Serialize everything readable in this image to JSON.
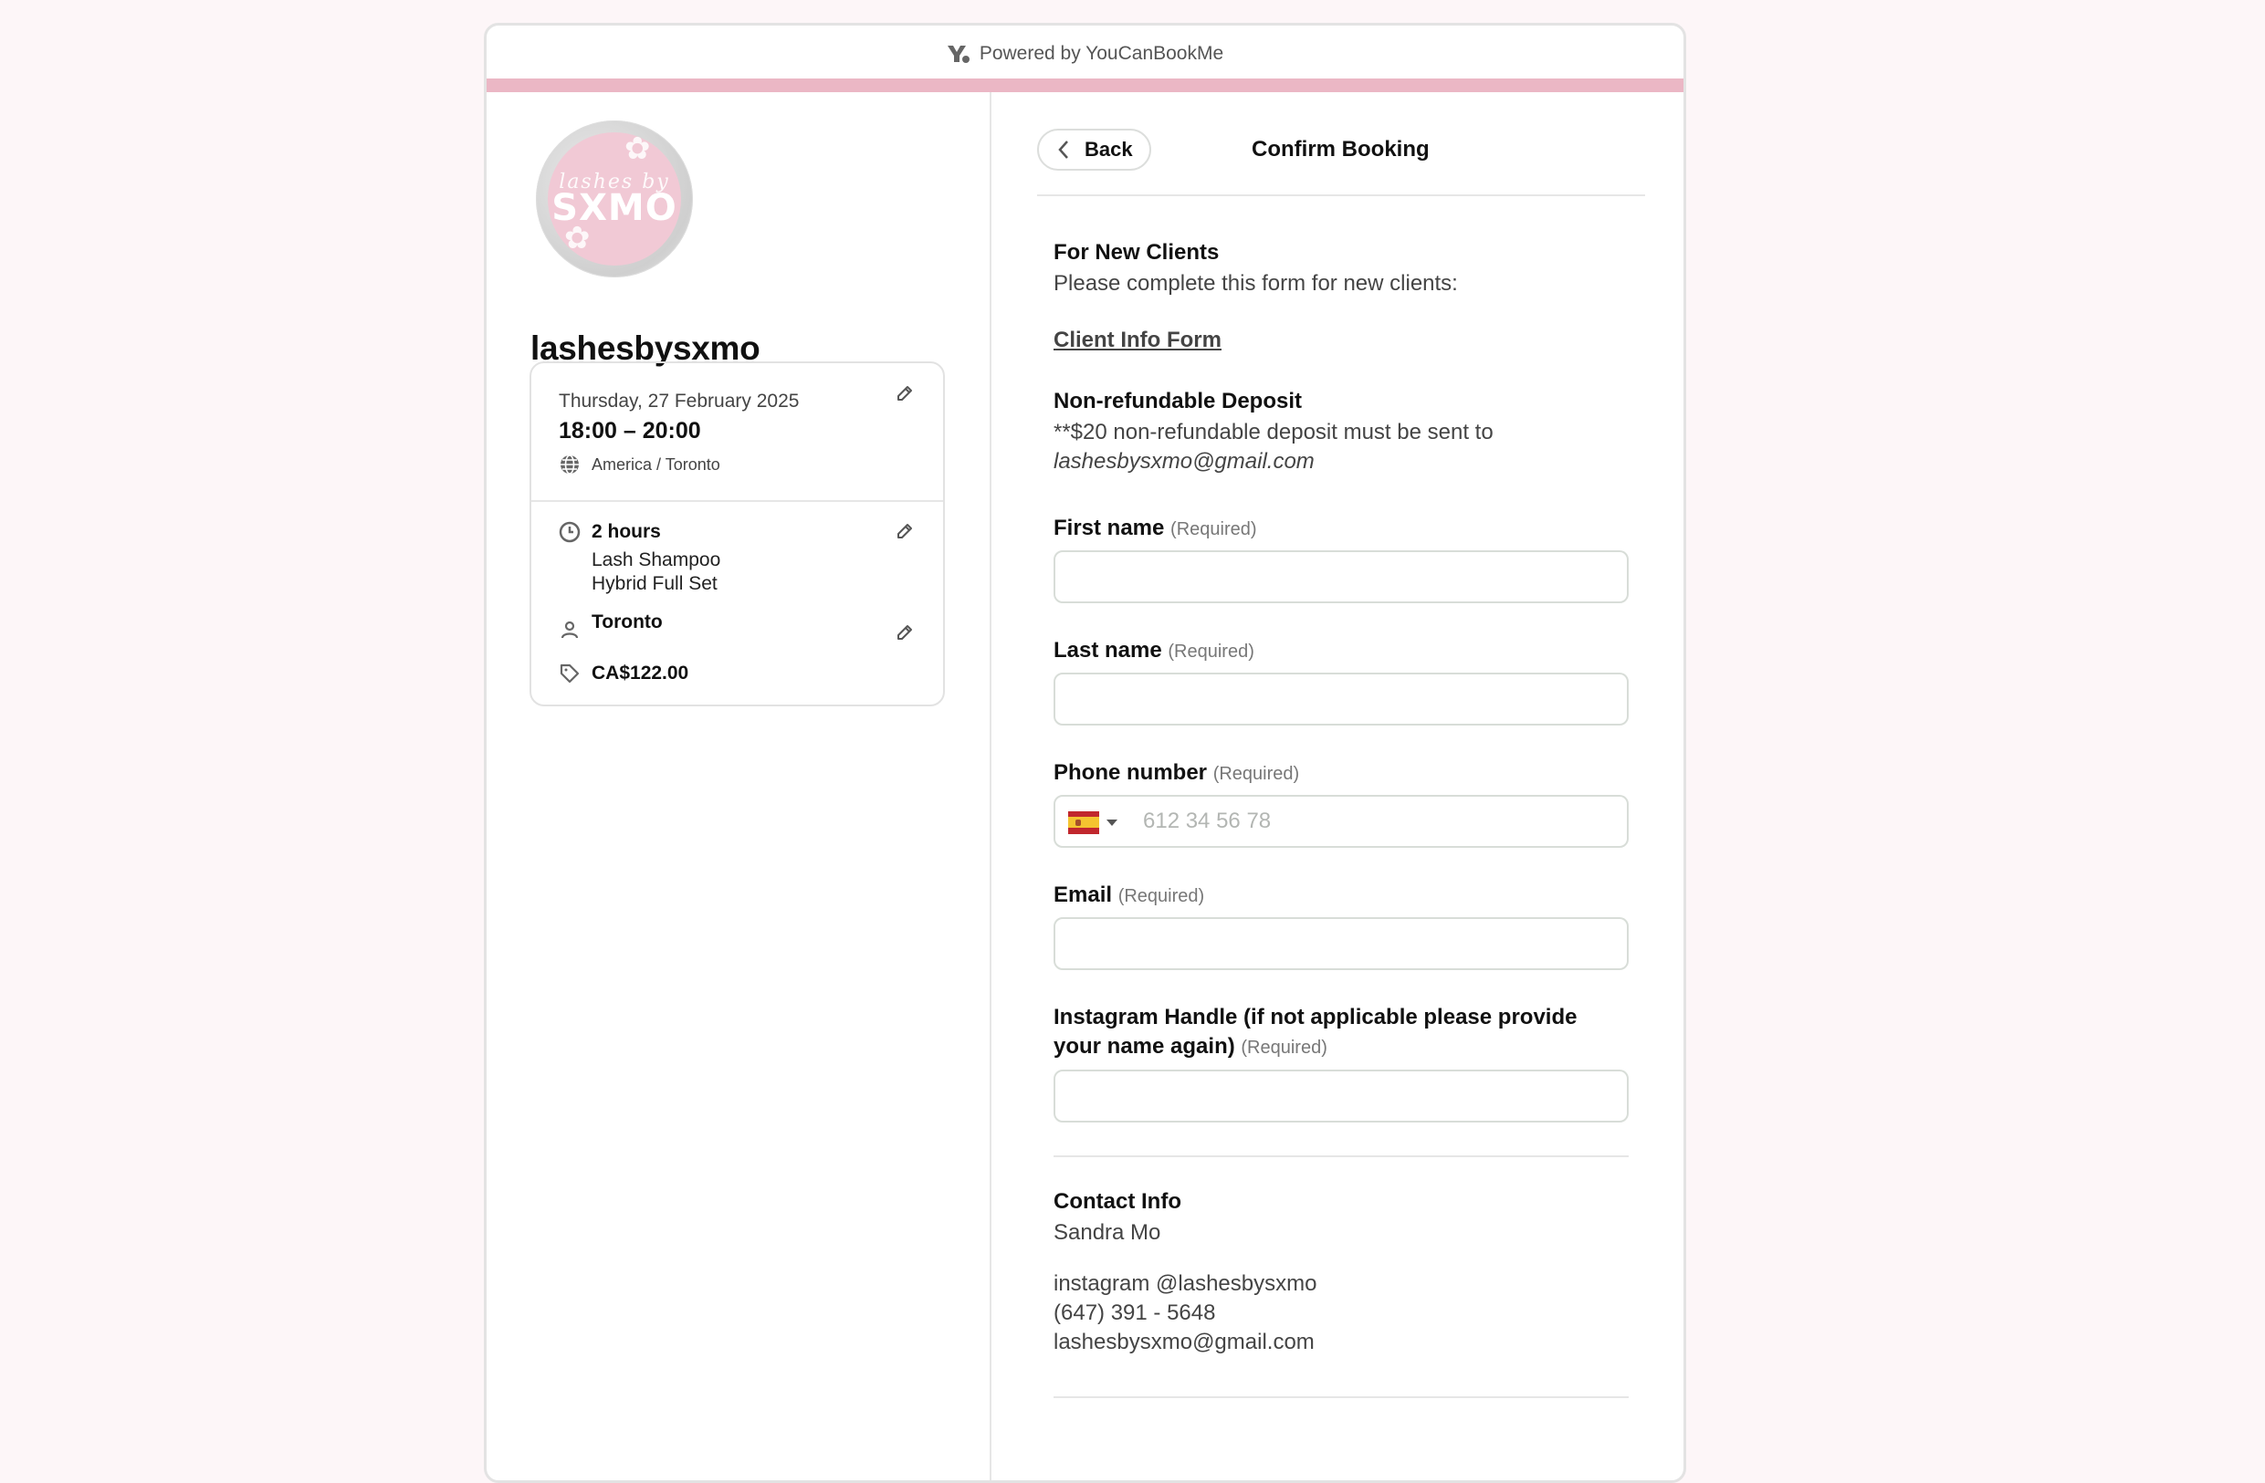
{
  "header": {
    "powered_by": "Powered by YouCanBookMe",
    "brand_color": "#ebb7c5"
  },
  "profile": {
    "logo_script": "lashes by",
    "logo_text": "SXMO",
    "name": "lashesbysxmo"
  },
  "booking": {
    "date": "Thursday, 27 February 2025",
    "time": "18:00 – 20:00",
    "timezone": "America / Toronto",
    "duration": "2 hours",
    "services": [
      "Lash Shampoo",
      "Hybrid Full Set"
    ],
    "location": "Toronto",
    "price": "CA$122.00"
  },
  "page": {
    "back_label": "Back",
    "title": "Confirm Booking"
  },
  "intro": {
    "new_clients_heading": "For New Clients",
    "new_clients_text": "Please complete this form for new clients:",
    "form_link": "Client Info Form",
    "deposit_heading": "Non-refundable Deposit",
    "deposit_text": "**$20 non-refundable deposit must be sent to",
    "deposit_email": "lashesbysxmo@gmail.com"
  },
  "form": {
    "required_tag": "(Required)",
    "fields": [
      {
        "label": "First name",
        "value": "",
        "placeholder": ""
      },
      {
        "label": "Last name",
        "value": "",
        "placeholder": ""
      },
      {
        "label": "Phone number",
        "value": "",
        "placeholder": "612 34 56 78",
        "country": "Spain"
      },
      {
        "label": "Email",
        "value": "",
        "placeholder": ""
      },
      {
        "label": "Instagram Handle (if not applicable please provide your name again)",
        "value": "",
        "placeholder": ""
      }
    ]
  },
  "contact": {
    "heading": "Contact Info",
    "name": "Sandra Mo",
    "instagram": "instagram @lashesbysxmo",
    "phone": "(647) 391 - 5648",
    "email": "lashesbysxmo@gmail.com"
  }
}
